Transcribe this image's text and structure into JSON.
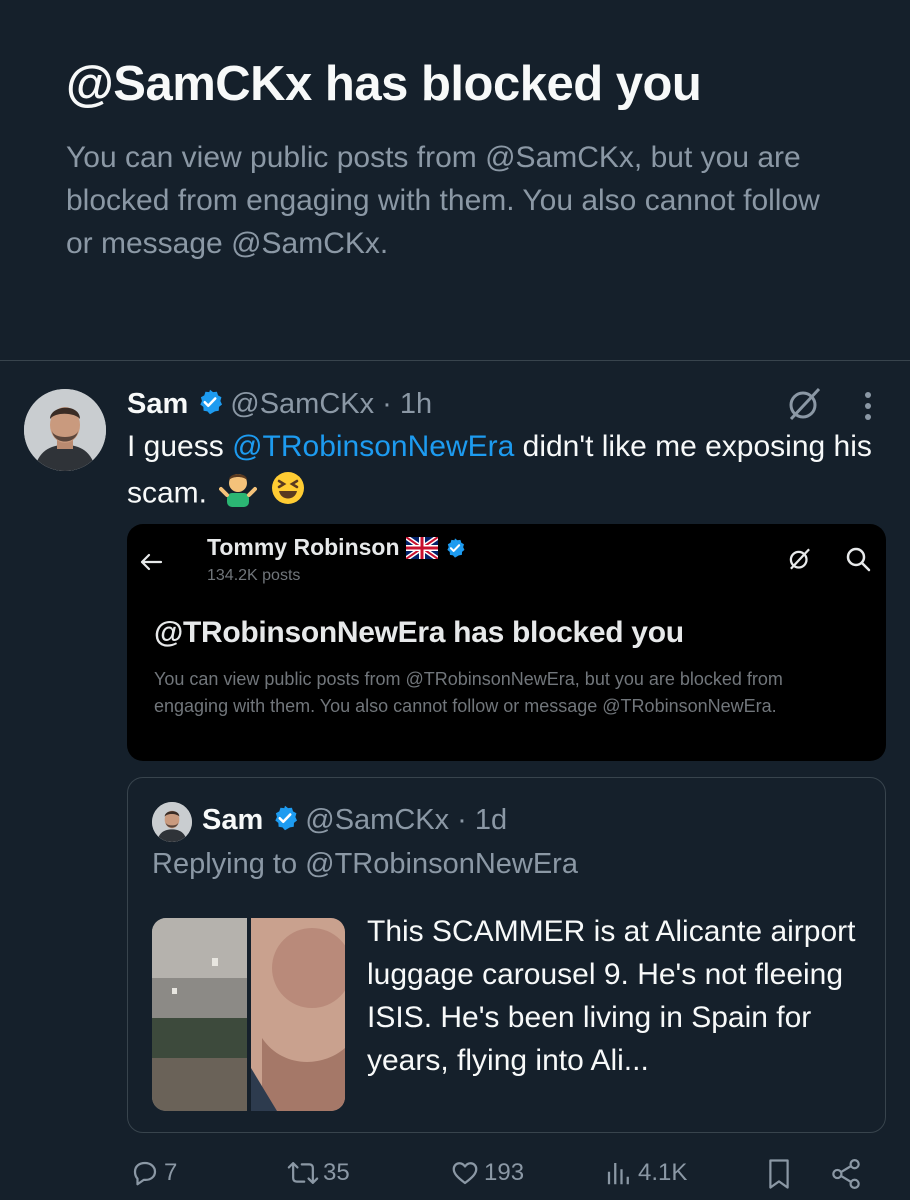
{
  "banner": {
    "title": "@SamCKx has blocked you",
    "text": "You can view public posts from @SamCKx, but you are blocked from engaging with them. You also cannot follow or message @SamCKx."
  },
  "post": {
    "name": "Sam",
    "handle_time": "@SamCKx · 1h",
    "text_before": "I guess ",
    "mention": "@TRobinsonNewEra",
    "text_after": " didn't like me exposing his scam."
  },
  "embed": {
    "name": "Tommy Robinson",
    "posts": "134.2K posts",
    "title": "@TRobinsonNewEra has blocked you",
    "text": "You can view public posts from @TRobinsonNewEra, but you are blocked from engaging with them. You also cannot follow or message @TRobinsonNewEra."
  },
  "quote": {
    "name": "Sam",
    "handle_time": "@SamCKx · 1d",
    "replying": "Replying to @TRobinsonNewEra",
    "text": "This SCAMMER is at Alicante airport luggage carousel 9. He's not fleeing ISIS. He's been living in Spain for years, flying into Ali..."
  },
  "actions": {
    "replies": "7",
    "reposts": "35",
    "likes": "193",
    "views": "4.1K"
  },
  "colors": {
    "background": "#15202b",
    "accent": "#1d9bf0",
    "muted": "#8b98a5",
    "border": "#38444d"
  },
  "icons": [
    "grok-icon",
    "more-icon",
    "verified-icon",
    "back-arrow-icon",
    "search-icon",
    "reply-icon",
    "repost-icon",
    "like-icon",
    "views-icon",
    "bookmark-icon",
    "share-icon"
  ]
}
